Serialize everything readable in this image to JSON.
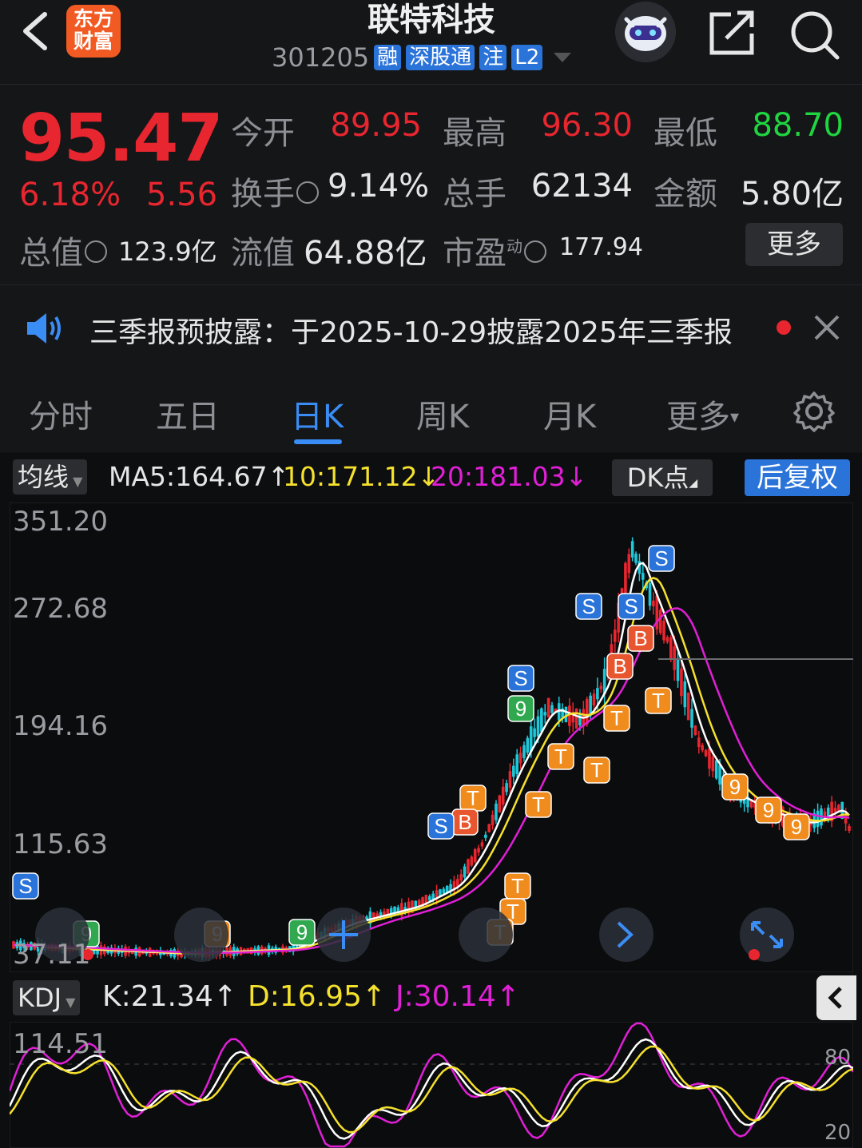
{
  "header": {
    "back_icon": "chevron-left-icon",
    "logo_line1": "东方",
    "logo_line2": "财富",
    "stock_name": "联特科技",
    "stock_code": "301205",
    "tags": [
      "融",
      "深股通",
      "注",
      "L2"
    ],
    "robot_icon": "robot-assistant-icon",
    "share_icon": "share-icon",
    "search_icon": "search-icon"
  },
  "quote": {
    "price": "95.47",
    "change_pct": "6.18%",
    "change_amt": "5.56",
    "open_label": "今开",
    "open_value": "89.95",
    "high_label": "最高",
    "high_value": "96.30",
    "low_label": "最低",
    "low_value": "88.70",
    "turnover_label": "换手",
    "turnover_value": "9.14%",
    "volume_label": "总手",
    "volume_value": "62134",
    "amount_label": "金额",
    "amount_value": "5.80亿",
    "mktcap_label": "总值",
    "mktcap_value": "123.9亿",
    "float_label": "流值",
    "float_value": "64.88亿",
    "pe_label": "市盈",
    "pe_sup": "动",
    "pe_value": "177.94",
    "more_label": "更多"
  },
  "notice": {
    "text": "三季报预披露：于2025-10-29披露2025年三季报",
    "speaker_icon": "speaker-icon",
    "close_icon": "close-icon"
  },
  "tabs": {
    "items": [
      "分时",
      "五日",
      "日K",
      "周K",
      "月K",
      "更多"
    ],
    "active": "日K",
    "settings_icon": "gear-icon"
  },
  "kline": {
    "indicator_chip": "均线",
    "ma5": "MA5:164.67↑",
    "ma10": "10:171.12↓",
    "ma20": "20:181.03↓",
    "dk_chip": "DK点",
    "adjust_button": "后复权",
    "y_ticks": [
      "351.20",
      "272.68",
      "194.16",
      "115.63",
      "37.11"
    ],
    "colors": {
      "up": "#e8262f",
      "down": "#1ec8d8",
      "ma5": "#ffffff",
      "ma10": "#f5e12d",
      "ma20": "#e01fd6"
    }
  },
  "kdj": {
    "chip": "KDJ",
    "k": "K:21.34↑",
    "d": "D:16.95↑",
    "j": "J:30.14↑",
    "y_top": "114.51",
    "right_80": "80",
    "right_20": "20",
    "collapse_icon": "chevron-left-icon"
  }
}
